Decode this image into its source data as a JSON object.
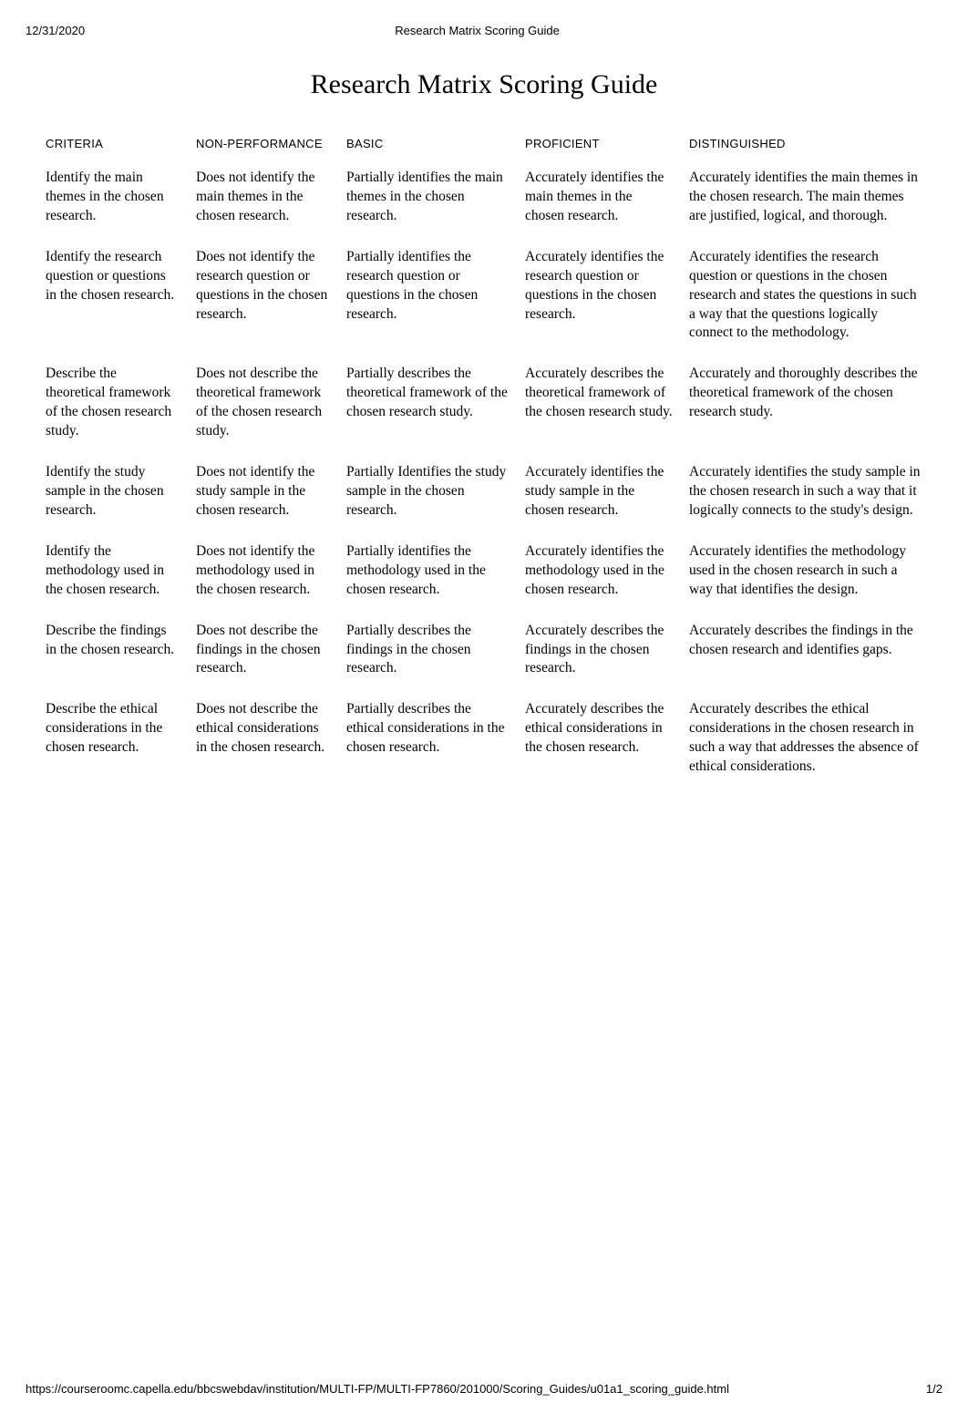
{
  "header": {
    "date": "12/31/2020",
    "doc_title_small": "Research Matrix Scoring Guide"
  },
  "main_title": "Research Matrix Scoring Guide",
  "columns": {
    "criteria": "CRITERIA",
    "non_performance": "NON-PERFORMANCE",
    "basic": "BASIC",
    "proficient": "PROFICIENT",
    "distinguished": "DISTINGUISHED"
  },
  "rows": [
    {
      "criteria": "Identify the main themes in the chosen research.",
      "non_performance": "Does not identify the main themes in the chosen research.",
      "basic": "Partially identifies the main themes in the chosen research.",
      "proficient": "Accurately identifies the main themes in the chosen research.",
      "distinguished": "Accurately identifies the main themes in the chosen research. The main themes are justified, logical, and thorough."
    },
    {
      "criteria": "Identify the research question or questions in the chosen research.",
      "non_performance": "Does not identify the research question or questions in the chosen research.",
      "basic": "Partially identifies the research question or questions in the chosen research.",
      "proficient": "Accurately identifies the research question or questions in the chosen research.",
      "distinguished": "Accurately identifies the research question or questions in the chosen research and states the questions in such a way that the questions logically connect to the methodology."
    },
    {
      "criteria": "Describe the theoretical framework of the chosen research study.",
      "non_performance": "Does not describe the theoretical framework of the chosen research study.",
      "basic": "Partially describes the theoretical framework of the chosen research study.",
      "proficient": "Accurately describes the theoretical framework of the chosen research study.",
      "distinguished": "Accurately and thoroughly describes the theoretical framework of the chosen research study."
    },
    {
      "criteria": "Identify the study sample in the chosen research.",
      "non_performance": "Does not identify the study sample in the chosen research.",
      "basic": "Partially Identifies the study sample in the chosen research.",
      "proficient": "Accurately identifies the study sample in the chosen research.",
      "distinguished": "Accurately identifies the study sample in the chosen research in such a way that it logically connects to the study's design."
    },
    {
      "criteria": "Identify the methodology used in the chosen research.",
      "non_performance": "Does not identify the methodology used in the chosen research.",
      "basic": "Partially identifies the methodology used in the chosen research.",
      "proficient": "Accurately identifies the methodology used in the chosen research.",
      "distinguished": "Accurately identifies the methodology used in the chosen research in such a way that identifies the design."
    },
    {
      "criteria": "Describe the findings in the chosen research.",
      "non_performance": "Does not describe the findings in the chosen research.",
      "basic": "Partially describes the findings in the chosen research.",
      "proficient": "Accurately describes the findings in the chosen research.",
      "distinguished": "Accurately describes the findings in the chosen research and identifies gaps."
    },
    {
      "criteria": "Describe the ethical considerations in the chosen research.",
      "non_performance": "Does not describe the ethical considerations in the chosen research.",
      "basic": "Partially describes the ethical considerations in the chosen research.",
      "proficient": "Accurately describes the ethical considerations in the chosen research.",
      "distinguished": "Accurately describes the ethical considerations in the chosen research in such a way that addresses the absence of ethical considerations."
    }
  ],
  "footer": {
    "url": "https://courseroomc.capella.edu/bbcswebdav/institution/MULTI-FP/MULTI-FP7860/201000/Scoring_Guides/u01a1_scoring_guide.html",
    "page": "1/2"
  }
}
